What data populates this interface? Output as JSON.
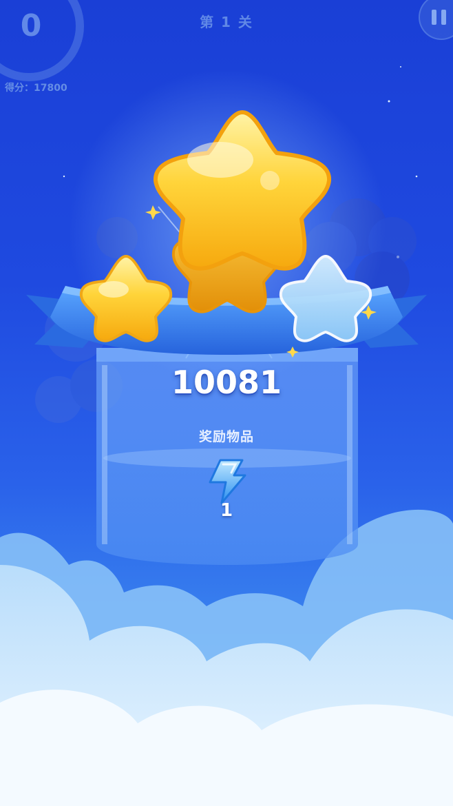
{
  "hud": {
    "moves_left": "0",
    "level_title": "第 1 关",
    "score_label": "得分：17800"
  },
  "buttons": {
    "pause_icon": "pause-icon"
  },
  "result_panel": {
    "stars_earned": 3,
    "stars_total": 3,
    "score": "10081",
    "reward_label": "奖励物品",
    "reward_item": {
      "icon": "lightning-icon",
      "count": "1"
    }
  },
  "colors": {
    "background_top": "#1a3fd6",
    "background_bottom": "#6fb6f6",
    "star_gold": "#ffc21a",
    "star_empty": "#bfe3ff",
    "ribbon": "#3d8ef0",
    "lightning": "#4fb2ff"
  }
}
